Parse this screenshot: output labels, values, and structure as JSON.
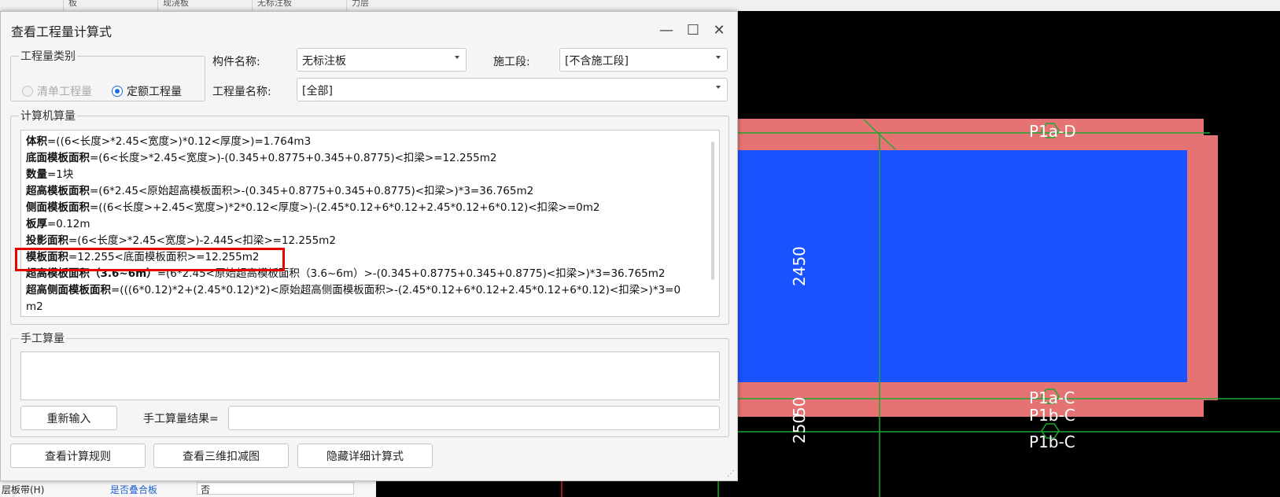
{
  "background": {
    "top_cells": [
      "板",
      "现浇板",
      "无标注板",
      "力层"
    ],
    "left_bottom": {
      "label": "层板带(H)",
      "link": "是否叠合板",
      "value": "否"
    },
    "cad": {
      "labels": [
        "P1a-D",
        "P1a-C",
        "P1b-C",
        "P1b-C"
      ],
      "dims": [
        "2450",
        "250",
        "50"
      ],
      "colors": {
        "slab": "#1b52ff",
        "beam": "#e67373",
        "axis": "#21a832",
        "background": "#000000"
      }
    }
  },
  "dialog": {
    "title": "查看工程量计算式",
    "window_buttons": {
      "minimize": "—",
      "maximize": "☐",
      "close": "✕"
    },
    "quantity_type": {
      "legend": "工程量类别",
      "options": [
        {
          "label": "清单工程量",
          "checked": false,
          "disabled": true
        },
        {
          "label": "定额工程量",
          "checked": true,
          "disabled": false
        }
      ]
    },
    "component_name": {
      "label": "构件名称:",
      "value": "无标注板"
    },
    "construction_stage": {
      "label": "施工段:",
      "value": "[不含施工段]"
    },
    "quantity_name": {
      "label": "工程量名称:",
      "value": "[全部]"
    },
    "computer_calc": {
      "legend": "计算机算量",
      "lines": [
        {
          "name": "体积",
          "expr": "=((6<长度>*2.45<宽度>)*0.12<厚度>)=1.764m3"
        },
        {
          "name": "底面模板面积",
          "expr": "=(6<长度>*2.45<宽度>)-(0.345+0.8775+0.345+0.8775)<扣梁>=12.255m2"
        },
        {
          "name": "数量",
          "expr": "=1块"
        },
        {
          "name": "超高模板面积",
          "expr": "=(6*2.45<原始超高模板面积>-(0.345+0.8775+0.345+0.8775)<扣梁>)*3=36.765m2"
        },
        {
          "name": "侧面模板面积",
          "expr": "=((6<长度>+2.45<宽度>)*2*0.12<厚度>)-(2.45*0.12+6*0.12+2.45*0.12+6*0.12)<扣梁>=0m2"
        },
        {
          "name": "板厚",
          "expr": "=0.12m"
        },
        {
          "name": "投影面积",
          "expr": "=(6<长度>*2.45<宽度>)-2.445<扣梁>=12.255m2"
        },
        {
          "name": "模板面积",
          "expr": "=12.255<底面模板面积>=12.255m2"
        },
        {
          "name": "超高模板面积（3.6~6m）",
          "expr": "=(6*2.45<原始超高模板面积（3.6~6m）>-(0.345+0.8775+0.345+0.8775)<扣梁>)*3=36.765m2"
        },
        {
          "name": "超高侧面模板面积",
          "expr": "=(((6*0.12)*2+(2.45*0.12)*2)<原始超高侧面模板面积>-(2.45*0.12+6*0.12+2.45*0.12+6*0.12)<扣梁>)*3=0"
        },
        {
          "name": "",
          "expr": "m2"
        }
      ]
    },
    "manual_calc": {
      "legend": "手工算量",
      "reinput_button": "重新输入",
      "result_label": "手工算量结果="
    },
    "footer_buttons": [
      "查看计算规则",
      "查看三维扣减图",
      "隐藏详细计算式"
    ]
  }
}
